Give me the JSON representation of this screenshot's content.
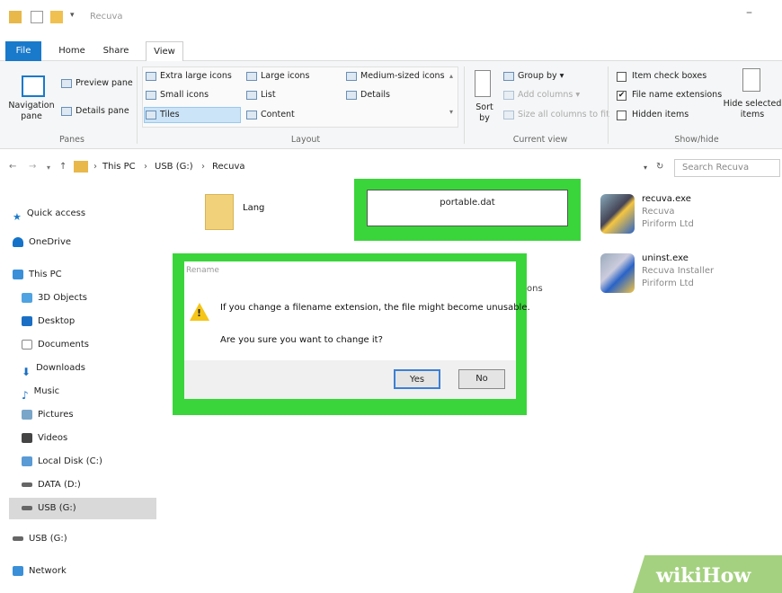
{
  "window": {
    "title": "Recuva",
    "minimize": "–"
  },
  "tabs": [
    {
      "label": "File"
    },
    {
      "label": "Home"
    },
    {
      "label": "Share"
    },
    {
      "label": "View"
    }
  ],
  "ribbon": {
    "panes": {
      "navigation_pane": "Navigation pane",
      "preview_pane": "Preview pane",
      "details_pane": "Details pane",
      "group": "Panes"
    },
    "layout": {
      "extra_large_icons": "Extra large icons",
      "large_icons": "Large icons",
      "medium_icons": "Medium-sized icons",
      "small_icons": "Small icons",
      "list": "List",
      "details": "Details",
      "tiles": "Tiles",
      "content": "Content",
      "group": "Layout"
    },
    "current_view": {
      "sort_by": "Sort by",
      "group_by": "Group by",
      "add_columns": "Add columns",
      "size_columns": "Size all columns to fit",
      "group": "Current view"
    },
    "show_hide": {
      "item_check_boxes": "Item check boxes",
      "file_name_extensions": "File name extensions",
      "hidden_items": "Hidden items",
      "hide_selected": "Hide selected items",
      "group": "Show/hide"
    }
  },
  "address": {
    "segments": [
      "This PC",
      "USB (G:)",
      "Recuva"
    ],
    "search_placeholder": "Search Recuva"
  },
  "sidebar": {
    "items": [
      {
        "label": "Quick access"
      },
      {
        "label": "OneDrive"
      },
      {
        "label": "This PC"
      },
      {
        "label": "3D Objects"
      },
      {
        "label": "Desktop"
      },
      {
        "label": "Documents"
      },
      {
        "label": "Downloads"
      },
      {
        "label": "Music"
      },
      {
        "label": "Pictures"
      },
      {
        "label": "Videos"
      },
      {
        "label": "Local Disk (C:)"
      },
      {
        "label": "DATA (D:)"
      },
      {
        "label": "USB (G:)"
      },
      {
        "label": "USB (G:)"
      },
      {
        "label": "Network"
      }
    ]
  },
  "files": {
    "lang": {
      "name": "Lang"
    },
    "rename_value": "portable.dat",
    "partial_text": "ons",
    "recuva_exe": {
      "name": "recuva.exe",
      "line2": "Recuva",
      "line3": "Piriform Ltd"
    },
    "uninst_exe": {
      "name": "uninst.exe",
      "line2": "Recuva Installer",
      "line3": "Piriform Ltd"
    }
  },
  "dialog": {
    "title": "Rename",
    "message1": "If you change a filename extension, the file might become unusable.",
    "message2": "Are you sure you want to change it?",
    "yes": "Yes",
    "no": "No"
  },
  "watermark": "wikiHow",
  "colors": {
    "highlight_green": "#3ad53a",
    "file_tab": "#1979ca",
    "wikihow_green": "#a4d17f"
  }
}
